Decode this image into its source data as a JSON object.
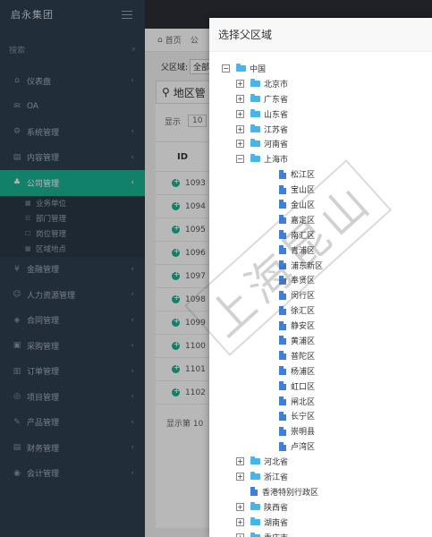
{
  "sidebar": {
    "brand": "启永集团",
    "search_placeholder": "搜索",
    "menu_top": [
      {
        "icon": "home-icon",
        "glyph": "⌂",
        "label": "仪表盘",
        "arrow": "‹"
      },
      {
        "icon": "email-icon",
        "glyph": "✉",
        "label": "OA",
        "arrow": ""
      },
      {
        "icon": "settings-icon",
        "glyph": "⚙",
        "label": "系统管理",
        "arrow": "‹"
      },
      {
        "icon": "content-icon",
        "glyph": "▤",
        "label": "内容管理",
        "arrow": "‹"
      },
      {
        "icon": "company-icon",
        "glyph": "♣",
        "label": "公司管理",
        "arrow": "‹"
      }
    ],
    "submenu": [
      {
        "glyph": "▦",
        "label": "业务单位"
      },
      {
        "glyph": "☷",
        "label": "部门管理"
      },
      {
        "glyph": "☐",
        "label": "岗位管理"
      },
      {
        "glyph": "▦",
        "label": "区域地点"
      }
    ],
    "menu_bottom": [
      {
        "icon": "finance-icon",
        "glyph": "¥",
        "label": "金融管理",
        "arrow": "‹"
      },
      {
        "icon": "hr-icon",
        "glyph": "☺",
        "label": "人力资源管理",
        "arrow": "‹"
      },
      {
        "icon": "contract-icon",
        "glyph": "◈",
        "label": "合同管理",
        "arrow": "‹"
      },
      {
        "icon": "purchase-icon",
        "glyph": "▣",
        "label": "采购管理",
        "arrow": "‹"
      },
      {
        "icon": "order-icon",
        "glyph": "▥",
        "label": "订单管理",
        "arrow": "‹"
      },
      {
        "icon": "project-icon",
        "glyph": "◎",
        "label": "项目管理",
        "arrow": "‹"
      },
      {
        "icon": "product-icon",
        "glyph": "✎",
        "label": "产品管理",
        "arrow": "‹"
      },
      {
        "icon": "account-icon",
        "glyph": "▤",
        "label": "财务管理",
        "arrow": "‹"
      },
      {
        "icon": "accounting-icon",
        "glyph": "◉",
        "label": "会计管理",
        "arrow": "‹"
      }
    ]
  },
  "main": {
    "crumb_home": "首页",
    "crumb_tail": "公",
    "filter_label": "父区域:",
    "filter_value": "全部",
    "panel_title": "地区管",
    "show_label": "显示",
    "show_value": "10",
    "id_header": "ID",
    "rows": [
      "1093",
      "1094",
      "1095",
      "1096",
      "1097",
      "1098",
      "1099",
      "1100",
      "1101",
      "1102"
    ],
    "footer": "显示第 10"
  },
  "modal": {
    "title": "选择父区域",
    "tree": [
      {
        "level": 0,
        "toggle": "−",
        "type": "folder",
        "label": "中国"
      },
      {
        "level": 1,
        "toggle": "+",
        "type": "folder",
        "label": "北京市"
      },
      {
        "level": 1,
        "toggle": "+",
        "type": "folder",
        "label": "广东省"
      },
      {
        "level": 1,
        "toggle": "+",
        "type": "folder",
        "label": "山东省"
      },
      {
        "level": 1,
        "toggle": "+",
        "type": "folder",
        "label": "江苏省"
      },
      {
        "level": 1,
        "toggle": "+",
        "type": "folder",
        "label": "河南省"
      },
      {
        "level": 1,
        "toggle": "−",
        "type": "folder",
        "label": "上海市"
      },
      {
        "level": 2,
        "toggle": "",
        "type": "file",
        "label": "松江区"
      },
      {
        "level": 2,
        "toggle": "",
        "type": "file",
        "label": "宝山区"
      },
      {
        "level": 2,
        "toggle": "",
        "type": "file",
        "label": "金山区"
      },
      {
        "level": 2,
        "toggle": "",
        "type": "file",
        "label": "嘉定区"
      },
      {
        "level": 2,
        "toggle": "",
        "type": "file",
        "label": "南汇区"
      },
      {
        "level": 2,
        "toggle": "",
        "type": "file",
        "label": "青浦区"
      },
      {
        "level": 2,
        "toggle": "",
        "type": "file",
        "label": "浦东新区"
      },
      {
        "level": 2,
        "toggle": "",
        "type": "file",
        "label": "奉贤区"
      },
      {
        "level": 2,
        "toggle": "",
        "type": "file",
        "label": "闵行区"
      },
      {
        "level": 2,
        "toggle": "",
        "type": "file",
        "label": "徐汇区"
      },
      {
        "level": 2,
        "toggle": "",
        "type": "file",
        "label": "静安区"
      },
      {
        "level": 2,
        "toggle": "",
        "type": "file",
        "label": "黄浦区"
      },
      {
        "level": 2,
        "toggle": "",
        "type": "file",
        "label": "普陀区"
      },
      {
        "level": 2,
        "toggle": "",
        "type": "file",
        "label": "杨浦区"
      },
      {
        "level": 2,
        "toggle": "",
        "type": "file",
        "label": "虹口区"
      },
      {
        "level": 2,
        "toggle": "",
        "type": "file",
        "label": "闸北区"
      },
      {
        "level": 2,
        "toggle": "",
        "type": "file",
        "label": "长宁区"
      },
      {
        "level": 2,
        "toggle": "",
        "type": "file",
        "label": "崇明县"
      },
      {
        "level": 2,
        "toggle": "",
        "type": "file",
        "label": "卢湾区"
      },
      {
        "level": 1,
        "toggle": "+",
        "type": "folder",
        "label": "河北省"
      },
      {
        "level": 1,
        "toggle": "+",
        "type": "folder",
        "label": "浙江省"
      },
      {
        "level": 1,
        "toggle": "",
        "type": "file",
        "label": "香港特别行政区"
      },
      {
        "level": 1,
        "toggle": "+",
        "type": "folder",
        "label": "陕西省"
      },
      {
        "level": 1,
        "toggle": "+",
        "type": "folder",
        "label": "湖南省"
      },
      {
        "level": 1,
        "toggle": "+",
        "type": "folder",
        "label": "重庆市"
      }
    ]
  },
  "watermark": "上海昆山"
}
